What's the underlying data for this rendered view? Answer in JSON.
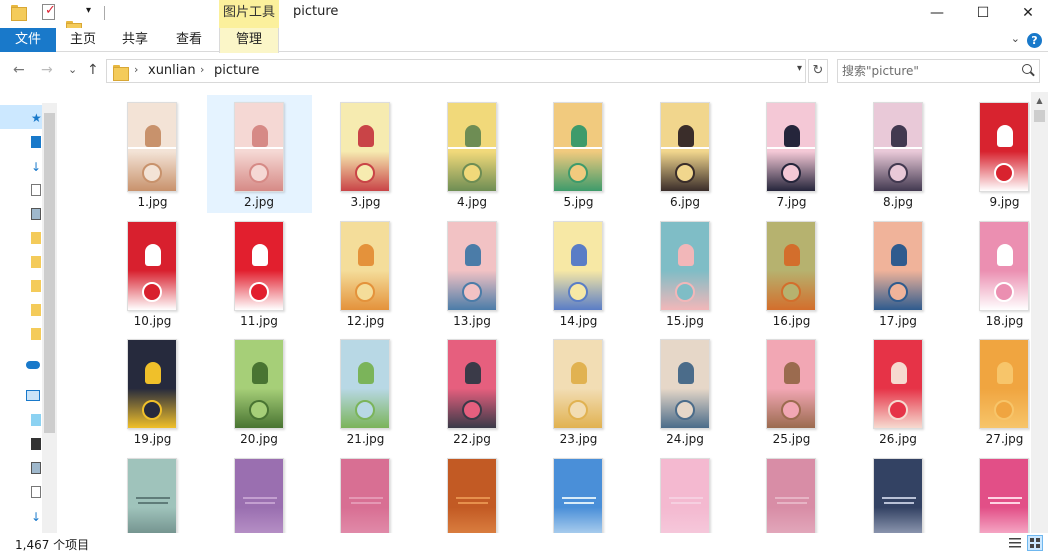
{
  "titlebar": {
    "context_tab_group": "图片工具",
    "title": "picture",
    "minimize": "—",
    "maximize": "☐",
    "close": "✕"
  },
  "ribbon": {
    "tabs": [
      "文件",
      "主页",
      "共享",
      "查看",
      "管理"
    ],
    "expand": "⌄",
    "help": "?"
  },
  "nav": {
    "back": "←",
    "forward": "→",
    "recent": "⌄",
    "up": "↑",
    "breadcrumb": [
      "xunlian",
      "picture"
    ],
    "refresh": "↻",
    "search_placeholder": "搜索\"picture\""
  },
  "files": [
    {
      "name": "1.jpg",
      "colors": [
        "#f3e3d6",
        "#c8926c"
      ],
      "split": true
    },
    {
      "name": "2.jpg",
      "colors": [
        "#f5d8d4",
        "#d68a86"
      ],
      "split": true,
      "selected": true
    },
    {
      "name": "3.jpg",
      "colors": [
        "#f6ebb0",
        "#c94447"
      ]
    },
    {
      "name": "4.jpg",
      "colors": [
        "#f1d97a",
        "#6e8d54"
      ],
      "split": true
    },
    {
      "name": "5.jpg",
      "colors": [
        "#f1ca7e",
        "#3e9b6b"
      ],
      "split": true
    },
    {
      "name": "6.jpg",
      "colors": [
        "#f1d68d",
        "#3a2d2a"
      ],
      "split": true
    },
    {
      "name": "7.jpg",
      "colors": [
        "#f4c8d6",
        "#25253b"
      ],
      "split": true
    },
    {
      "name": "8.jpg",
      "colors": [
        "#e9c9d8",
        "#423950"
      ],
      "split": true
    },
    {
      "name": "9.jpg",
      "colors": [
        "#d8232f",
        "#ffffff"
      ]
    },
    {
      "name": "10.jpg",
      "colors": [
        "#d8202e",
        "#ffffff"
      ]
    },
    {
      "name": "11.jpg",
      "colors": [
        "#e21f2e",
        "#ffffff"
      ]
    },
    {
      "name": "12.jpg",
      "colors": [
        "#f4dd9a",
        "#e4923b"
      ]
    },
    {
      "name": "13.jpg",
      "colors": [
        "#f2c2c4",
        "#4b7ca8"
      ]
    },
    {
      "name": "14.jpg",
      "colors": [
        "#f7e8a5",
        "#5a7dc6"
      ]
    },
    {
      "name": "15.jpg",
      "colors": [
        "#7fbdc6",
        "#f2b7b9"
      ]
    },
    {
      "name": "16.jpg",
      "colors": [
        "#b6b26f",
        "#d36e2c"
      ]
    },
    {
      "name": "17.jpg",
      "colors": [
        "#f0b39a",
        "#2f5b8e"
      ]
    },
    {
      "name": "18.jpg",
      "colors": [
        "#eb8fb1",
        "#ffffff"
      ]
    },
    {
      "name": "19.jpg",
      "colors": [
        "#262a3d",
        "#f0c02a"
      ]
    },
    {
      "name": "20.jpg",
      "colors": [
        "#a6cf78",
        "#497432"
      ]
    },
    {
      "name": "21.jpg",
      "colors": [
        "#b8d8e5",
        "#7bb45a"
      ]
    },
    {
      "name": "22.jpg",
      "colors": [
        "#e65f7e",
        "#3a3a48"
      ]
    },
    {
      "name": "23.jpg",
      "colors": [
        "#f2ddb4",
        "#e1b251"
      ]
    },
    {
      "name": "24.jpg",
      "colors": [
        "#e6d7c8",
        "#4b6c8a"
      ]
    },
    {
      "name": "25.jpg",
      "colors": [
        "#f2a7b4",
        "#9b6b4f"
      ]
    },
    {
      "name": "26.jpg",
      "colors": [
        "#e63347",
        "#f6dad0"
      ]
    },
    {
      "name": "27.jpg",
      "colors": [
        "#f0a540",
        "#f7c56a"
      ]
    },
    {
      "name": "",
      "colors": [
        "#9fc3bb",
        "#5f7c79"
      ]
    },
    {
      "name": "",
      "colors": [
        "#9a6fb0",
        "#c39fd0"
      ]
    },
    {
      "name": "",
      "colors": [
        "#d86f93",
        "#e598b4"
      ]
    },
    {
      "name": "",
      "colors": [
        "#c25a24",
        "#e6904d"
      ]
    },
    {
      "name": "",
      "colors": [
        "#4a8fd8",
        "#d9ecf8"
      ]
    },
    {
      "name": "",
      "colors": [
        "#f4b9d0",
        "#f6cfe0"
      ]
    },
    {
      "name": "",
      "colors": [
        "#d88da6",
        "#e7b4c5"
      ]
    },
    {
      "name": "",
      "colors": [
        "#334263",
        "#b9c1d6"
      ]
    },
    {
      "name": "",
      "colors": [
        "#e24f87",
        "#ffd4e4"
      ]
    }
  ],
  "status": {
    "count": "1,467 个项目"
  },
  "colors": {
    "accent": "#1979ca",
    "selection": "#e5f3ff",
    "context_tab": "#fbf09c"
  }
}
